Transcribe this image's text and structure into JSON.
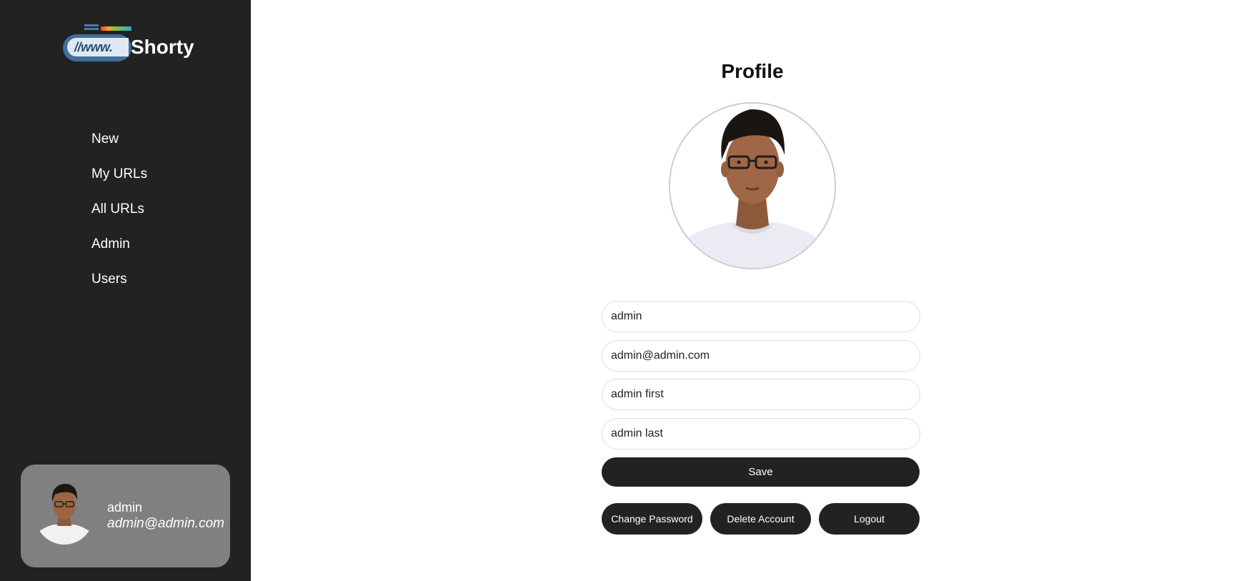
{
  "app": {
    "logo_prefix": "//www.",
    "logo_name": "Shorty"
  },
  "sidebar": {
    "items": [
      {
        "label": "New"
      },
      {
        "label": "My URLs"
      },
      {
        "label": "All URLs"
      },
      {
        "label": "Admin"
      },
      {
        "label": "Users"
      }
    ],
    "user": {
      "name": "admin",
      "email": "admin@admin.com"
    }
  },
  "profile": {
    "title": "Profile",
    "fields": {
      "username": "admin",
      "email": "admin@admin.com",
      "first_name": "admin first",
      "last_name": "admin last"
    },
    "save_label": "Save",
    "change_password_label": "Change Password",
    "delete_account_label": "Delete Account",
    "logout_label": "Logout"
  },
  "colors": {
    "sidebar_bg": "#222222",
    "button_bg": "#222222",
    "user_card_bg": "#808080",
    "logo_blue": "#3f6f9c"
  },
  "icons": {
    "avatar": "person-photo"
  }
}
